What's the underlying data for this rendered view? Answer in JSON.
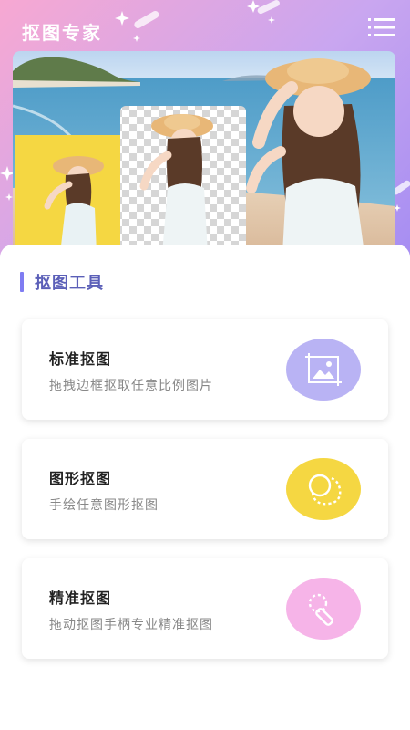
{
  "header": {
    "title": "抠图专家",
    "menu_icon": "menu-icon"
  },
  "banner": {
    "image": "banner-photo"
  },
  "section": {
    "title": "抠图工具"
  },
  "cards": [
    {
      "title": "标准抠图",
      "desc": "拖拽边框抠取任意比例图片",
      "icon": "image-frame-icon",
      "icon_color": "#b9b3f4"
    },
    {
      "title": "图形抠图",
      "desc": "手绘任意图形抠图",
      "icon": "shape-lasso-icon",
      "icon_color": "#f5d742"
    },
    {
      "title": "精准抠图",
      "desc": "拖动抠图手柄专业精准抠图",
      "icon": "precision-handle-icon",
      "icon_color": "#f6b4e8"
    }
  ]
}
